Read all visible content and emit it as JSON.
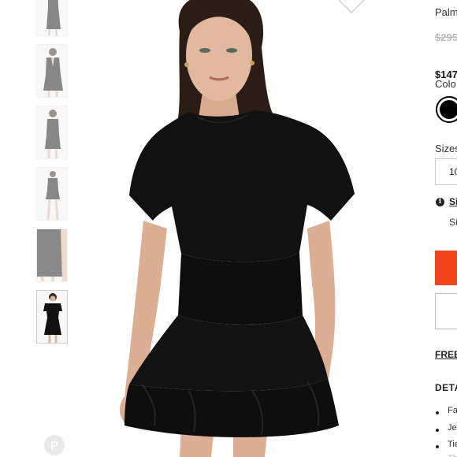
{
  "product": {
    "brand_partial": "Palm",
    "original_price_partial": "$295",
    "sale_price_partial": "$147",
    "color_label_partial": "Colo",
    "selected_color": "#000000",
    "sizes_label_partial": "Sizes",
    "selected_size_partial": "10",
    "size_guide_partial": "Si",
    "size_note_partial": "Si",
    "free_shipping_partial": "FREE",
    "details_heading_partial": "DETA",
    "details_items_partial": [
      "Fa",
      "Jev",
      "Tie",
      "Th"
    ]
  },
  "gallery": {
    "thumbnail_count": 6,
    "active_thumbnail_index": 5
  },
  "icons": {
    "heart": "heart-icon",
    "pinterest": "pinterest-icon",
    "info": "info-icon",
    "pinterest_glyph": "P",
    "info_glyph": "i"
  },
  "colors": {
    "accent": "#f0441e",
    "dress": "#111111"
  }
}
